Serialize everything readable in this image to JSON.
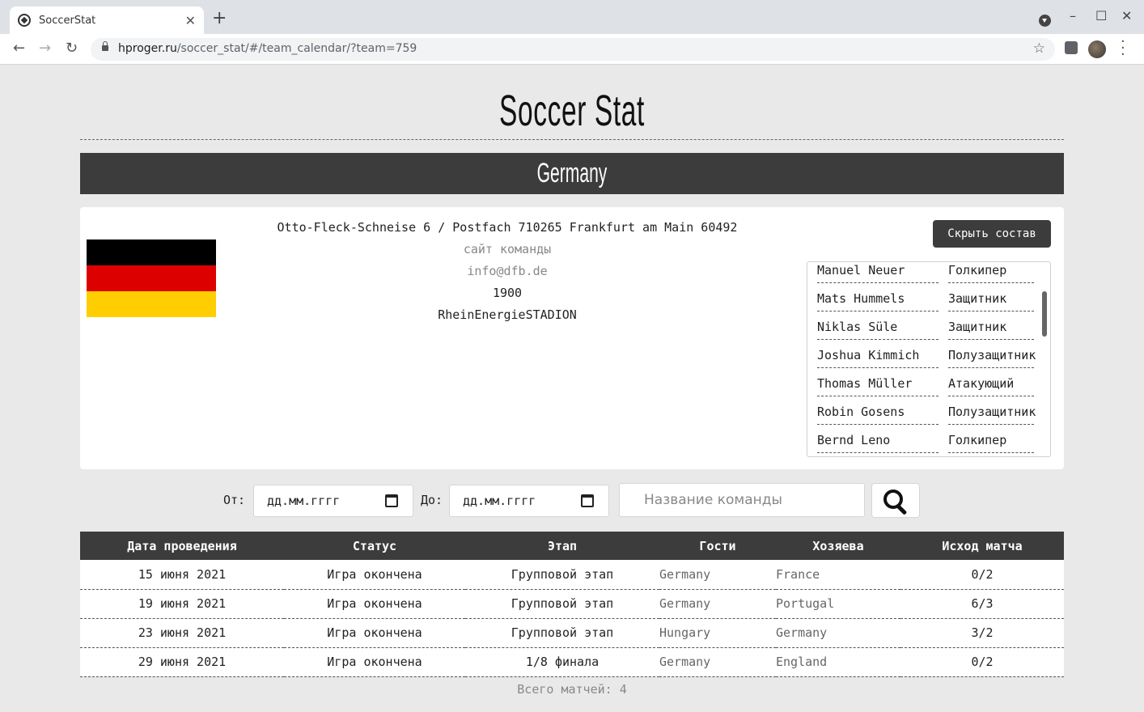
{
  "browser": {
    "tab_title": "SoccerStat",
    "new_tab": "+",
    "tab_close": "✕",
    "url_host": "hproger.ru",
    "url_path": "/soccer_stat/#/team_calendar/?team=759",
    "win_minimize": "–",
    "win_maximize": "☐",
    "win_close": "✕"
  },
  "site": {
    "title": "Soccer Stat"
  },
  "team": {
    "name": "Germany",
    "flag_colors": [
      "#000000",
      "#dd0000",
      "#ffce00"
    ],
    "address": "Otto-Fleck-Schneise 6 / Postfach 710265 Frankfurt am Main 60492",
    "website_label": "сайт команды",
    "email": "info@dfb.de",
    "founded": "1900",
    "venue": "RheinEnergieSTADION",
    "hide_squad_label": "Скрыть состав"
  },
  "squad": [
    {
      "name": "Manuel Neuer",
      "position": "Голкипер"
    },
    {
      "name": "Mats Hummels",
      "position": "Защитник"
    },
    {
      "name": "Niklas Süle",
      "position": "Защитник"
    },
    {
      "name": "Joshua Kimmich",
      "position": "Полузащитник"
    },
    {
      "name": "Thomas Müller",
      "position": "Атакующий"
    },
    {
      "name": "Robin Gosens",
      "position": "Полузащитник"
    },
    {
      "name": "Bernd Leno",
      "position": "Голкипер"
    }
  ],
  "filters": {
    "from_label": "От:",
    "to_label": "До:",
    "from_placeholder": "дд.мм.гггг",
    "to_placeholder": "дд.мм.гггг",
    "team_placeholder": "Название команды"
  },
  "matches": {
    "headers": [
      "Дата проведения",
      "Статус",
      "Этап",
      "Гости",
      "Хозяева",
      "Исход матча"
    ],
    "rows": [
      [
        "15 июня 2021",
        "Игра окончена",
        "Групповой этап",
        "Germany",
        "France",
        "0/2"
      ],
      [
        "19 июня 2021",
        "Игра окончена",
        "Групповой этап",
        "Germany",
        "Portugal",
        "6/3"
      ],
      [
        "23 июня 2021",
        "Игра окончена",
        "Групповой этап",
        "Hungary",
        "Germany",
        "3/2"
      ],
      [
        "29 июня 2021",
        "Игра окончена",
        "1/8 финала",
        "Germany",
        "England",
        "0/2"
      ]
    ],
    "total": "Всего матчей: 4"
  }
}
